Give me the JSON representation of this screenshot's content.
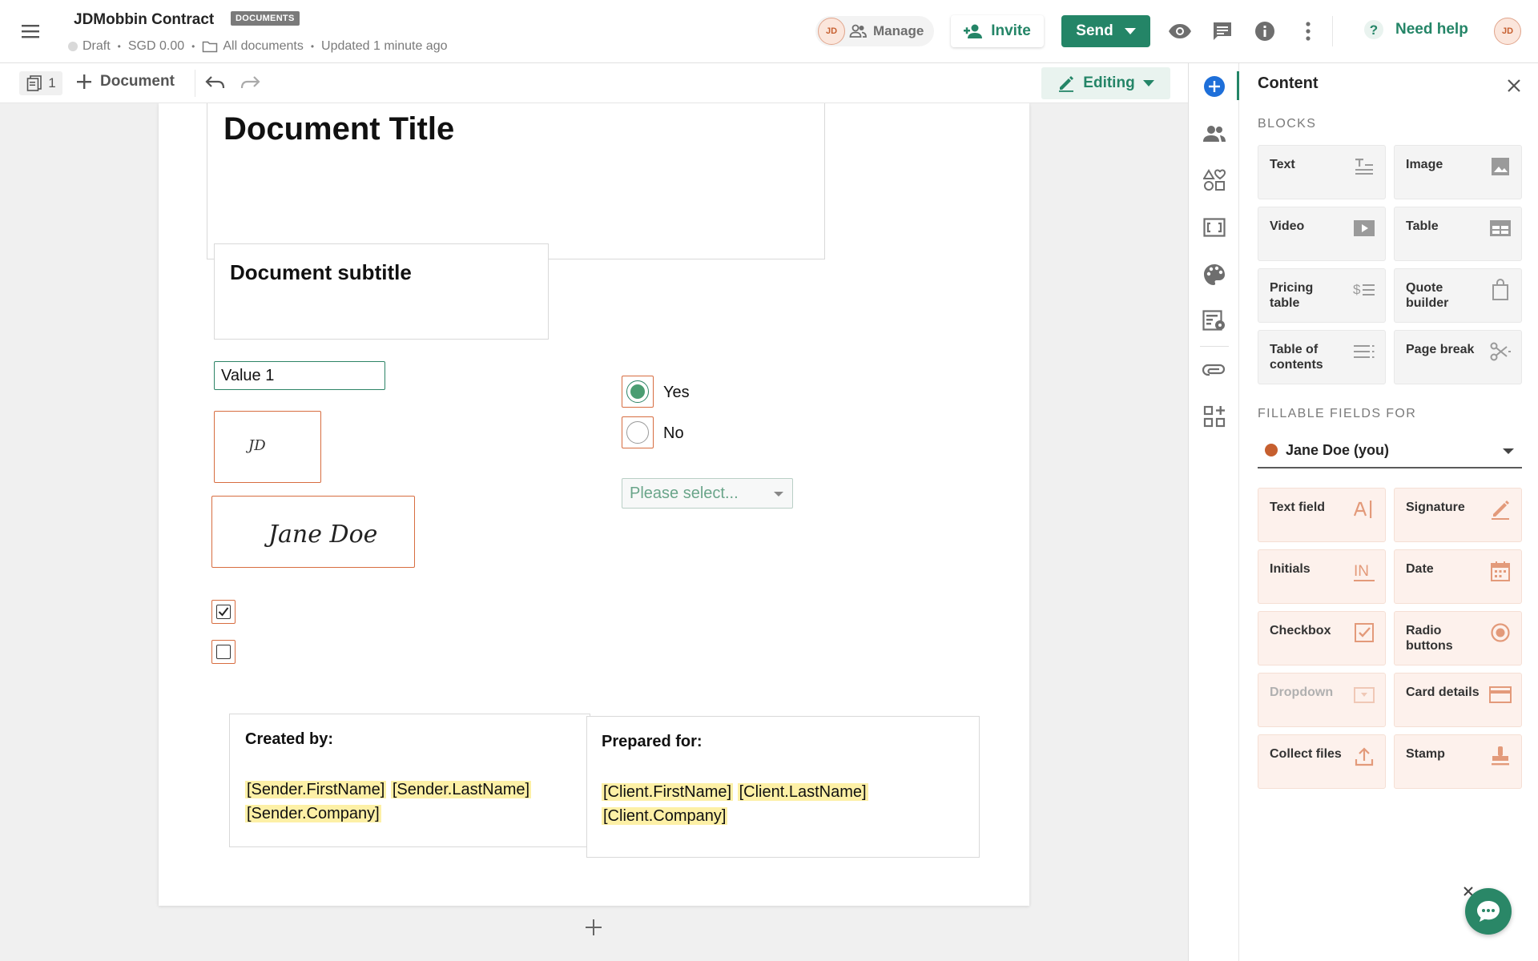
{
  "header": {
    "document_name": "JDMobbin Contract",
    "badge": "DOCUMENTS",
    "status": "Draft",
    "amount": "SGD 0.00",
    "folder": "All documents",
    "updated": "Updated 1 minute ago",
    "avatar_initials": "JD",
    "manage_label": "Manage",
    "invite_label": "Invite",
    "send_label": "Send",
    "help_label": "Need help",
    "icons": [
      "menu-icon",
      "eye-icon",
      "comment-icon",
      "info-icon",
      "more-vertical-icon",
      "help-icon"
    ]
  },
  "toolbar": {
    "page_count": "1",
    "add_document_label": "Document",
    "mode_label": "Editing"
  },
  "document": {
    "title": "Document Title",
    "subtitle": "Document subtitle",
    "text_field_value": "Value 1",
    "initials": "JD",
    "signature": "Jane Doe",
    "checkboxes": [
      true,
      false
    ],
    "radio_options": [
      {
        "label": "Yes",
        "selected": true
      },
      {
        "label": "No",
        "selected": false
      }
    ],
    "dropdown_placeholder": "Please select...",
    "created_by": {
      "heading": "Created by:",
      "first_name": "[Sender.FirstName]",
      "last_name": "[Sender.LastName]",
      "company": "[Sender.Company]"
    },
    "prepared_for": {
      "heading": "Prepared for:",
      "first_name": "[Client.FirstName]",
      "last_name": "[Client.LastName]",
      "company": "[Client.Company]"
    }
  },
  "panel": {
    "title": "Content",
    "blocks_heading": "BLOCKS",
    "blocks": [
      {
        "label": "Text",
        "icon": "text-block-icon"
      },
      {
        "label": "Image",
        "icon": "image-block-icon"
      },
      {
        "label": "Video",
        "icon": "video-block-icon"
      },
      {
        "label": "Table",
        "icon": "table-block-icon"
      },
      {
        "label": "Pricing\ntable",
        "icon": "pricing-table-icon"
      },
      {
        "label": "Quote\nbuilder",
        "icon": "quote-builder-icon"
      },
      {
        "label": "Table of\ncontents",
        "icon": "toc-icon"
      },
      {
        "label": "Page break",
        "icon": "scissors-icon"
      }
    ],
    "fields_heading": "FILLABLE FIELDS FOR",
    "recipient": "Jane Doe (you)",
    "fields": [
      {
        "label": "Text field",
        "icon": "text-field-icon",
        "enabled": true
      },
      {
        "label": "Signature",
        "icon": "signature-pen-icon",
        "enabled": true
      },
      {
        "label": "Initials",
        "icon": "initials-icon",
        "enabled": true
      },
      {
        "label": "Date",
        "icon": "calendar-icon",
        "enabled": true
      },
      {
        "label": "Checkbox",
        "icon": "checkbox-icon",
        "enabled": true
      },
      {
        "label": "Radio\nbuttons",
        "icon": "radio-icon",
        "enabled": true
      },
      {
        "label": "Dropdown",
        "icon": "dropdown-icon",
        "enabled": false
      },
      {
        "label": "Card details",
        "icon": "card-icon",
        "enabled": true
      },
      {
        "label": "Collect files",
        "icon": "upload-icon",
        "enabled": true
      },
      {
        "label": "Stamp",
        "icon": "stamp-icon",
        "enabled": true
      }
    ]
  },
  "rail": {
    "icons": [
      "add-content-icon",
      "recipients-icon",
      "design-elements-icon",
      "variables-icon",
      "theme-palette-icon",
      "workflow-icon",
      "attachment-icon",
      "apps-icon"
    ]
  },
  "colors": {
    "brand_green": "#248567",
    "field_orange": "#d76d40",
    "variable_highlight": "#fdf0a6",
    "rail_active_blue": "#1e6fd9"
  }
}
